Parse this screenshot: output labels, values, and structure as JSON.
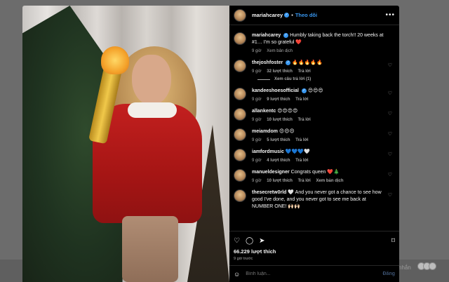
{
  "post": {
    "username": "mariahcarey",
    "follow_label": "Theo dõi",
    "more_label": "•••",
    "caption": {
      "username": "mariahcarey",
      "text": "Humbly taking back the torch!! 20 weeks at #1… I'm so grateful ❤️",
      "time": "9 giờ",
      "translate": "Xem bản dịch"
    }
  },
  "comments": [
    {
      "user": "thejoshfoster",
      "verified": true,
      "text": "🔥🔥🔥🔥🔥",
      "time": "9 giờ",
      "likes": "32 lượt thích",
      "reply": "Trả lời",
      "extra": ""
    },
    {
      "user": "kandeeshoesofficial",
      "verified": true,
      "text": "😍😍😍",
      "time": "9 giờ",
      "likes": "9 lượt thích",
      "reply": "Trả lời",
      "extra": ""
    },
    {
      "user": "allankentc",
      "verified": false,
      "text": "😍😍😍😍",
      "time": "9 giờ",
      "likes": "10 lượt thích",
      "reply": "Trả lời",
      "extra": ""
    },
    {
      "user": "meiamdom",
      "verified": false,
      "text": "😍😍😍",
      "time": "9 giờ",
      "likes": "5 lượt thích",
      "reply": "Trả lời",
      "extra": ""
    },
    {
      "user": "iamfordmusic",
      "verified": false,
      "text": "💙💙💙🤍",
      "time": "9 giờ",
      "likes": "4 lượt thích",
      "reply": "Trả lời",
      "extra": ""
    },
    {
      "user": "manueldesigner",
      "verified": false,
      "text": "Congrats queen ❤️🎄",
      "time": "9 giờ",
      "likes": "10 lượt thích",
      "reply": "Trả lời",
      "extra": "Xem bản dịch"
    },
    {
      "user": "thesecretw0rld",
      "verified": false,
      "text": "🤍 And you never got a chance to see how good I've done, and you never got to see me back at NUMBER ONE! 🙌🏻🙌🏻",
      "time": "",
      "likes": "",
      "reply": "",
      "extra": ""
    }
  ],
  "view_replies": "Xem câu trả lời (1)",
  "actions": {
    "like_icon": "heart-icon",
    "comment_icon": "comment-icon",
    "share_icon": "share-icon",
    "save_icon": "bookmark-icon"
  },
  "likes_count": "66.229 lượt thích",
  "posted_ago": "9 giờ trước",
  "compose": {
    "placeholder": "Bình luận...",
    "post_label": "Đăng"
  },
  "background_text": "nhắn",
  "colors": {
    "panel_bg": "#000000",
    "accent_blue": "#3897f0",
    "backdrop": "#6b6b6b"
  }
}
